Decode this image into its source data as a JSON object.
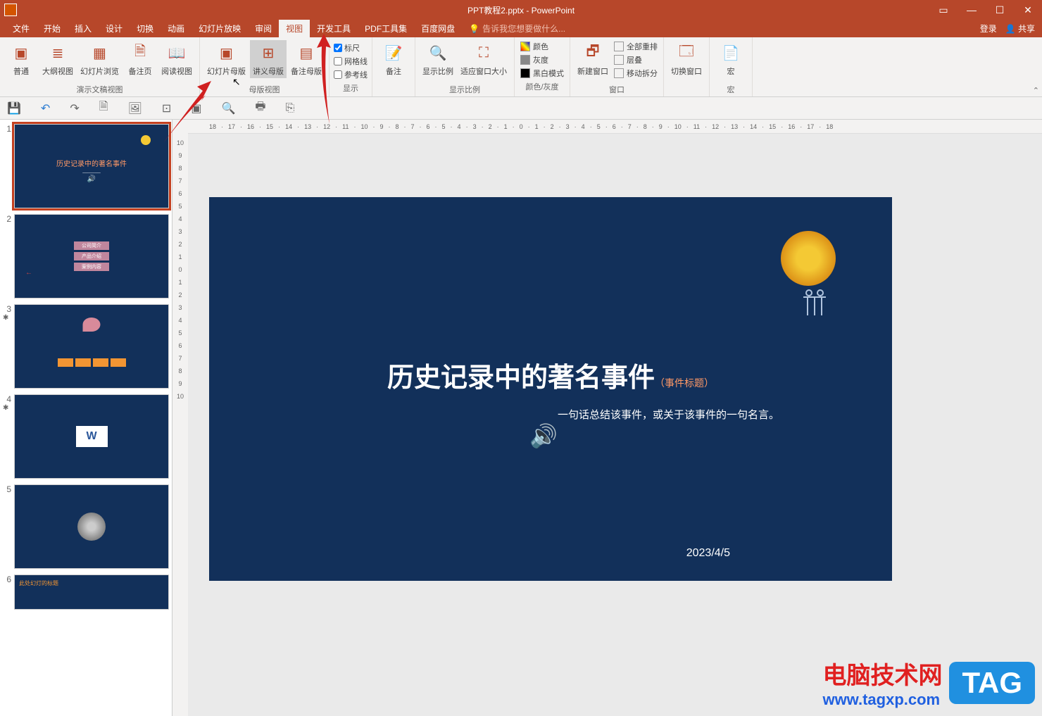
{
  "window": {
    "title": "PPT教程2.pptx - PowerPoint",
    "login": "登录",
    "share": "共享"
  },
  "menu": {
    "file": "文件",
    "home": "开始",
    "insert": "插入",
    "design": "设计",
    "transitions": "切换",
    "animations": "动画",
    "slideshow": "幻灯片放映",
    "review": "审阅",
    "view": "视图",
    "developer": "开发工具",
    "pdftools": "PDF工具集",
    "baidu": "百度网盘",
    "tellme": "告诉我您想要做什么..."
  },
  "ribbon": {
    "normal": "普通",
    "outline": "大纲视图",
    "sorter": "幻灯片浏览",
    "notes_page": "备注页",
    "reading": "阅读视图",
    "group_presentation_views": "演示文稿视图",
    "slide_master": "幻灯片母版",
    "handout_master": "讲义母版",
    "notes_master": "备注母版",
    "group_master_views": "母版视图",
    "ruler": "标尺",
    "gridlines": "网格线",
    "guides": "参考线",
    "group_show": "显示",
    "notes": "备注",
    "zoom": "显示比例",
    "fit": "适应窗口大小",
    "group_zoom": "显示比例",
    "color": "颜色",
    "grayscale": "灰度",
    "blackwhite": "黑白模式",
    "group_color": "颜色/灰度",
    "new_window": "新建窗口",
    "arrange_all": "全部重排",
    "cascade": "层叠",
    "move_split": "移动拆分",
    "group_window": "窗口",
    "switch_window": "切换窗口",
    "macros": "宏",
    "group_macros": "宏"
  },
  "slides": {
    "s1": {
      "num": "1"
    },
    "s2": {
      "num": "2",
      "item1": "公司简介",
      "item2": "产品介绍",
      "item3": "案例内容"
    },
    "s3": {
      "num": "3"
    },
    "s4": {
      "num": "4"
    },
    "s5": {
      "num": "5"
    },
    "s6": {
      "num": "6",
      "title": "此处幻灯的标题"
    }
  },
  "canvas": {
    "title": "历史记录中的著名事件",
    "title_sub": "（事件标题）",
    "subtitle": "一句话总结该事件，或关于该事件的一句名言。",
    "date": "2023/4/5",
    "thumb_title": "历史记录中的著名事件"
  },
  "ruler_h": [
    "18",
    "17",
    "16",
    "15",
    "14",
    "13",
    "12",
    "11",
    "10",
    "9",
    "8",
    "7",
    "6",
    "5",
    "4",
    "3",
    "2",
    "1",
    "0",
    "1",
    "2",
    "3",
    "4",
    "5",
    "6",
    "7",
    "8",
    "9",
    "10",
    "11",
    "12",
    "13",
    "14",
    "15",
    "16",
    "17",
    "18"
  ],
  "ruler_v": [
    "10",
    "9",
    "8",
    "7",
    "6",
    "5",
    "4",
    "3",
    "2",
    "1",
    "0",
    "1",
    "2",
    "3",
    "4",
    "5",
    "6",
    "7",
    "8",
    "9",
    "10"
  ],
  "watermark": {
    "line1": "电脑技术网",
    "line2": "www.tagxp.com",
    "tag": "TAG"
  }
}
